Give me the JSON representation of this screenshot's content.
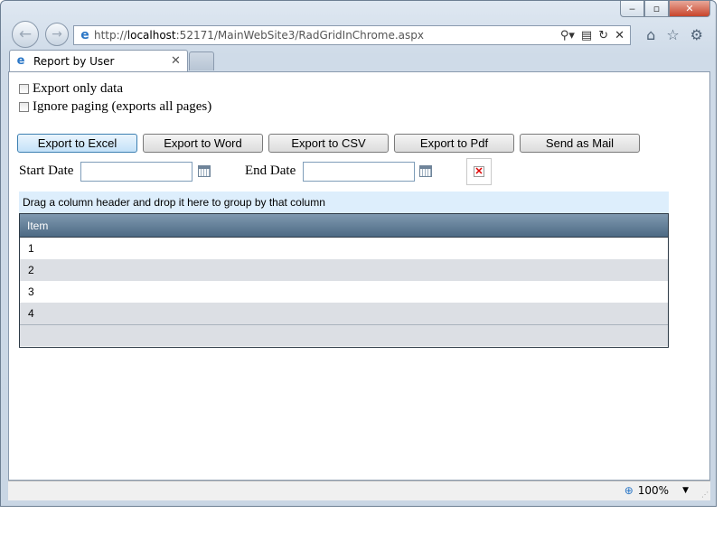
{
  "browser": {
    "url_prefix": "http://",
    "url_host": "localhost",
    "url_rest": ":52171/MainWebSite3/RadGridInChrome.aspx",
    "tab_title": "Report by User",
    "zoom": "100%",
    "icons": [
      "back-icon",
      "forward-icon",
      "search-icon",
      "compat-icon",
      "refresh-icon",
      "stop-icon",
      "home-icon",
      "favorites-icon",
      "settings-icon"
    ]
  },
  "options": {
    "export_only_data": "Export only data",
    "ignore_paging": "Ignore paging (exports all pages)"
  },
  "buttons": {
    "excel": "Export to Excel",
    "word": "Export to Word",
    "csv": "Export to CSV",
    "pdf": "Export to Pdf",
    "mail": "Send as Mail"
  },
  "dates": {
    "start_label": "Start Date",
    "end_label": "End Date",
    "start_value": "",
    "end_value": ""
  },
  "grid": {
    "group_panel": "Drag a column header and drop it here to group by that column",
    "columns": [
      "Item"
    ],
    "rows": [
      "1",
      "2",
      "3",
      "4"
    ]
  }
}
